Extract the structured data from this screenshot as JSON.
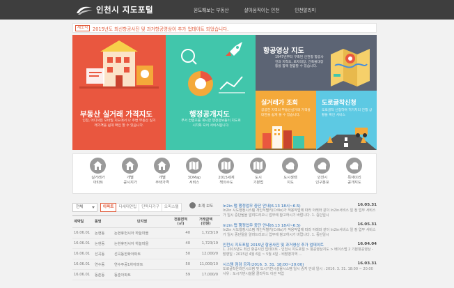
{
  "header": {
    "logo_text": "인천시 지도포털",
    "nav": [
      "원도해보는 부동산",
      "살아움직이는 인천",
      "인천알리미"
    ]
  },
  "notice": {
    "badge": "새소식",
    "text": "2015년도 최신항공사진 및 과거항공영상이 추가 업데이트 되었습니다."
  },
  "tiles": {
    "realestate": {
      "title": "부동산 실거래 가격지도",
      "desc": "인천, 어디서든 모바일 지도에서 나 주변 부동산 실거래가격을 쉽게 확인 할 수 있습니다."
    },
    "admin": {
      "title": "행정공개지도",
      "desc": "부서 컨텐츠를 게시한 행정정보들이 지도로 시각화 되어 서비스됩니다."
    },
    "aerial": {
      "title": "항공영상 지도",
      "desc": "1947년부터 구축된 인천항 항공사진과 지적도, 토지대장, 건축물대장 등을 함께 열람할 수 있습니다."
    },
    "trade": {
      "title": "실거래가 조회",
      "desc": "공공한 지역의 부동산실거래 가격을 대한을 쉽게 볼 수 있습니다."
    },
    "road": {
      "title": "도로굴착신청",
      "desc": "도로굴착 신청하여 허가처리 진행 상황을 확인 서비스"
    }
  },
  "menu": [
    {
      "label": "실거래가\n아파트",
      "icon": "house-chart-icon"
    },
    {
      "label": "개별\n공시지가",
      "icon": "house-chart-icon"
    },
    {
      "label": "개별\n주택가격",
      "icon": "house-chart-icon"
    },
    {
      "label": "3DMap\n서비스",
      "icon": "map-icon"
    },
    {
      "label": "2015세계\n책의수도",
      "icon": "map-icon"
    },
    {
      "label": "도시\n기본법",
      "icon": "map-icon"
    },
    {
      "label": "도시생태\n지도",
      "icon": "cloud-icon"
    },
    {
      "label": "인천시\n인구분포",
      "icon": "cloud-icon"
    },
    {
      "label": "목재이리\n공개지도",
      "icon": "cloud-icon"
    }
  ],
  "listing": {
    "select": "전체",
    "tabs": [
      "아파트",
      "다세대연립",
      "단독다가구",
      "오피스텔"
    ],
    "columns": [
      "계약일",
      "동명",
      "단지명",
      "전용면적\n(㎡)",
      "거래금액\n(만원)"
    ],
    "rows": [
      [
        "16.06.01",
        "논현동",
        "논현휴먼시아 하늘마을",
        "40",
        "1,723/19"
      ],
      [
        "16.06.01",
        "논현동",
        "논현휴먼시아 하늘마을",
        "40",
        "1,723/19"
      ],
      [
        "16.06.01",
        "선곡동",
        "선곡동한화아파트",
        "50",
        "12,000/0"
      ],
      [
        "16.06.01",
        "연수동",
        "연수주공1차아파트",
        "50",
        "11,000/10"
      ],
      [
        "16.06.01",
        "동춘동",
        "동춘아파트",
        "59",
        "17,000/0"
      ]
    ]
  },
  "news_head": "초계 보도",
  "news": [
    {
      "title": "In2in 맵 행정업무 중단 안내(6.13 18시~6.5)",
      "date": "16.05.31",
      "body": "In2in 시도행정시스템 개인식별키(CrNo)가 적용작업에 따라 아래와 같이 In2in서비스 일 정 업무 서비스가 일시 중단될을 알려드리오니 업무에 참고하시기 바랍니다. 1. 중단일시"
    },
    {
      "title": "In2in 맵 행정업무 중단 안내(6.13 18시~6.5)",
      "date": "16.05.31",
      "body": "In2in 시도행정시스템 개인식별키(CrNo)가 적용작업에 따라 아래와 같이 In2in서비스 일 정 업무 서비스가 일시 중단될을 알려드리오니 업무에 참고하시기 바랍니다. 1. 중단일시"
    },
    {
      "title": "인천시 지도포털 2015년 항공사진 및 과거영상 추가 업데이트",
      "date": "16.04.04",
      "body": "1. 2015년도 최신 항공사진 업데이트 - 인천시 지도포털 > 항공영상지도 > 배이스맵 2 기본항공영상 - 촬영일 : 2015년 4월 6일 ~ 5월 4일 - 비촬영지역 ..."
    },
    {
      "title": "시스템 점검 공지(2016. 3. 31. 18:00~20:00)",
      "date": "16.03.31",
      "body": "도로굴착온라인시스템 및 도시기반시설물시스템 일시 중지 안내 일시 : 2016. 3. 31. 18:00 ~ 20:00 사유 : 도시기반시설물 클라우드 이관 작업"
    }
  ],
  "colors": {
    "header_bg": "#3e3e3e",
    "accent": "#e05a3a",
    "realestate": "#e9573f",
    "admin": "#41c6ab",
    "aerial": "#5c6474",
    "trade": "#f4a93a",
    "road": "#5dc9e3"
  }
}
